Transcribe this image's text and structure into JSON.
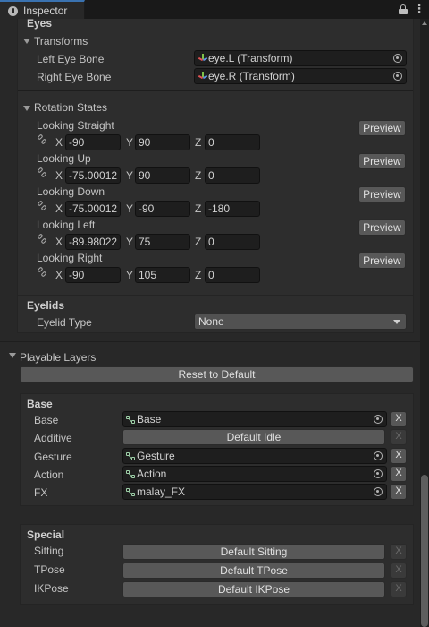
{
  "window": {
    "tab_label": "Inspector",
    "tab_icon": "info-icon"
  },
  "eyes": {
    "section_title": "Eyes",
    "transforms_title": "Transforms",
    "left_eye_bone_label": "Left Eye Bone",
    "left_eye_bone_value": "eye.L (Transform)",
    "right_eye_bone_label": "Right Eye Bone",
    "right_eye_bone_value": "eye.R (Transform)",
    "rotation_states_title": "Rotation States",
    "preview_label": "Preview",
    "axis_x": "X",
    "axis_y": "Y",
    "axis_z": "Z",
    "states": [
      {
        "label": "Looking Straight",
        "x": "-90",
        "y": "90",
        "z": "0"
      },
      {
        "label": "Looking Up",
        "x": "-75.00012",
        "y": "90",
        "z": "0"
      },
      {
        "label": "Looking Down",
        "x": "-75.00012",
        "y": "-90",
        "z": "-180"
      },
      {
        "label": "Looking Left",
        "x": "-89.98022",
        "y": "75",
        "z": "0"
      },
      {
        "label": "Looking Right",
        "x": "-90",
        "y": "105",
        "z": "0"
      }
    ]
  },
  "eyelids": {
    "section_title": "Eyelids",
    "type_label": "Eyelid Type",
    "type_value": "None"
  },
  "playable_layers": {
    "title": "Playable Layers",
    "reset_label": "Reset to Default",
    "x_label": "X",
    "base_section": {
      "title": "Base",
      "rows": [
        {
          "label": "Base",
          "kind": "asset",
          "value": "Base"
        },
        {
          "label": "Additive",
          "kind": "default",
          "value": "Default Idle"
        },
        {
          "label": "Gesture",
          "kind": "asset",
          "value": "Gesture"
        },
        {
          "label": "Action",
          "kind": "asset",
          "value": "Action"
        },
        {
          "label": "FX",
          "kind": "asset",
          "value": "malay_FX"
        }
      ]
    },
    "special_section": {
      "title": "Special",
      "rows": [
        {
          "label": "Sitting",
          "value": "Default Sitting"
        },
        {
          "label": "TPose",
          "value": "Default TPose"
        },
        {
          "label": "IKPose",
          "value": "Default IKPose"
        }
      ]
    }
  }
}
